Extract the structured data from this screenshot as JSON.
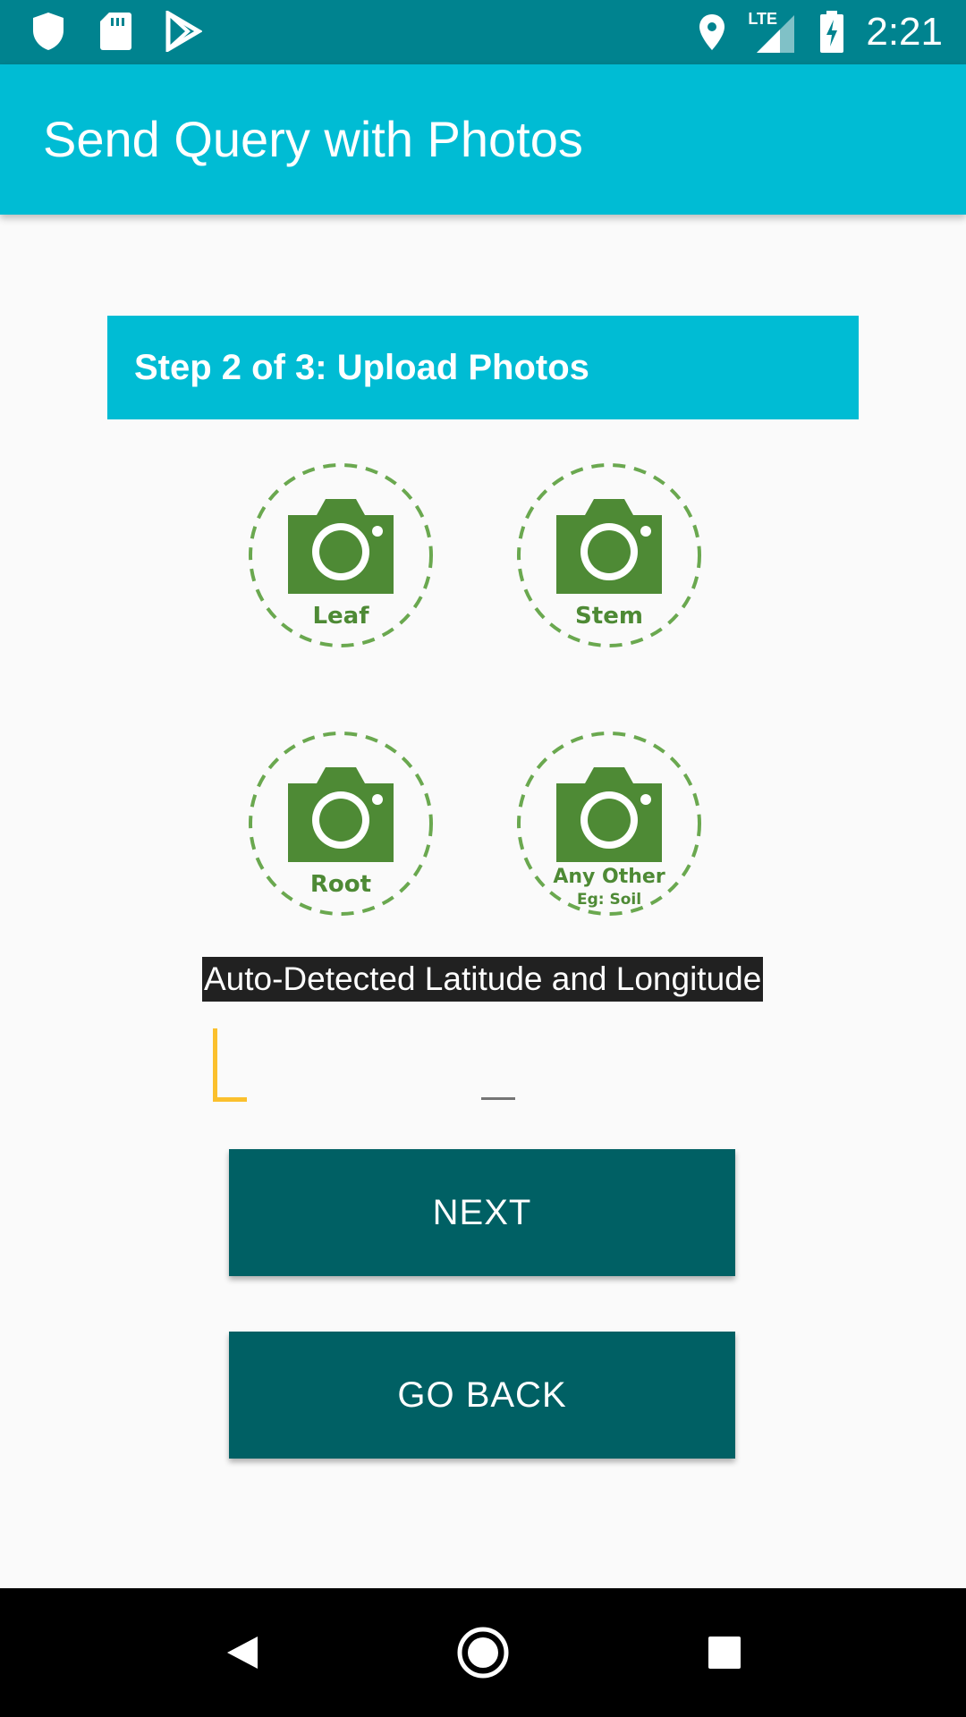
{
  "status_bar": {
    "time": "2:21",
    "network": "LTE",
    "icons": [
      "shield-icon",
      "sd-card-icon",
      "play-store-icon",
      "location-icon",
      "signal-icon",
      "battery-charging-icon"
    ]
  },
  "app_bar": {
    "title": "Send Query with Photos"
  },
  "step": {
    "title": "Step 2 of 3: Upload Photos"
  },
  "photos": [
    {
      "label": "Leaf",
      "sublabel": ""
    },
    {
      "label": "Stem",
      "sublabel": ""
    },
    {
      "label": "Root",
      "sublabel": ""
    },
    {
      "label": "Any Other",
      "sublabel": "Eg: Soil"
    }
  ],
  "location": {
    "label": "Auto-Detected Latitude and Longitude",
    "value": ""
  },
  "buttons": {
    "next": "NEXT",
    "back": "GO BACK"
  },
  "colors": {
    "status_bar": "#00838f",
    "app_bar": "#00bcd4",
    "button": "#006064",
    "photo_green": "#4e8a35",
    "cursor": "#fbc02d"
  },
  "nav_bar": {
    "icons": [
      "back-icon",
      "home-icon",
      "recents-icon"
    ]
  }
}
